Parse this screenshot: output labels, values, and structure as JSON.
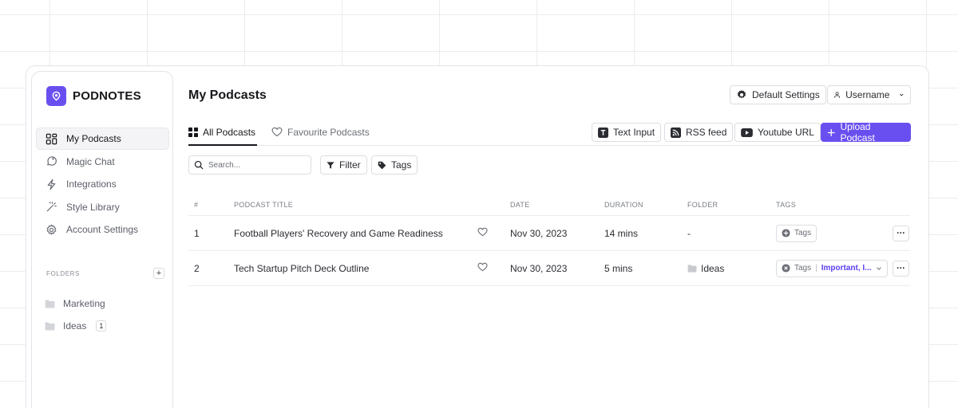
{
  "brand": {
    "name": "PODNOTES"
  },
  "sidebar": {
    "items": [
      {
        "label": "My Podcasts",
        "icon": "grid-icon",
        "active": true
      },
      {
        "label": "Magic Chat",
        "icon": "chat-icon"
      },
      {
        "label": "Integrations",
        "icon": "lightning-icon"
      },
      {
        "label": "Style Library",
        "icon": "magic-wand-icon"
      },
      {
        "label": "Account Settings",
        "icon": "gear-icon"
      }
    ],
    "folders_label": "FOLDERS",
    "add_folder": "+",
    "folders": [
      {
        "label": "Marketing"
      },
      {
        "label": "Ideas",
        "count": "1"
      }
    ]
  },
  "header": {
    "title": "My Podcasts",
    "default_settings": "Default Settings",
    "username": "Username"
  },
  "tabs": [
    {
      "label": "All Podcasts",
      "active": true
    },
    {
      "label": "Favourite Podcasts"
    }
  ],
  "actions": {
    "text_input": "Text Input",
    "rss_feed": "RSS feed",
    "youtube_url": "Youtube URL",
    "upload": "Upload Podcast"
  },
  "toolbar": {
    "search_placeholder": "Search...",
    "filter": "Filter",
    "tags": "Tags"
  },
  "table": {
    "columns": [
      "#",
      "PODCAST TITLE",
      "DATE",
      "DURATION",
      "FOLDER",
      "TAGS"
    ],
    "rows": [
      {
        "num": "1",
        "title": "Football Players' Recovery and Game Readiness",
        "date": "Nov 30, 2023",
        "duration": "14 mins",
        "folder": "-",
        "tags_label": "Tags"
      },
      {
        "num": "2",
        "title": "Tech Startup Pitch Deck Outline",
        "date": "Nov 30, 2023",
        "duration": "5 mins",
        "folder": "Ideas",
        "tags_label": "Tags",
        "tags_values": "Important, I..."
      }
    ]
  },
  "colors": {
    "accent": "#6a4ff0",
    "tag_text": "#5a3ff0"
  }
}
